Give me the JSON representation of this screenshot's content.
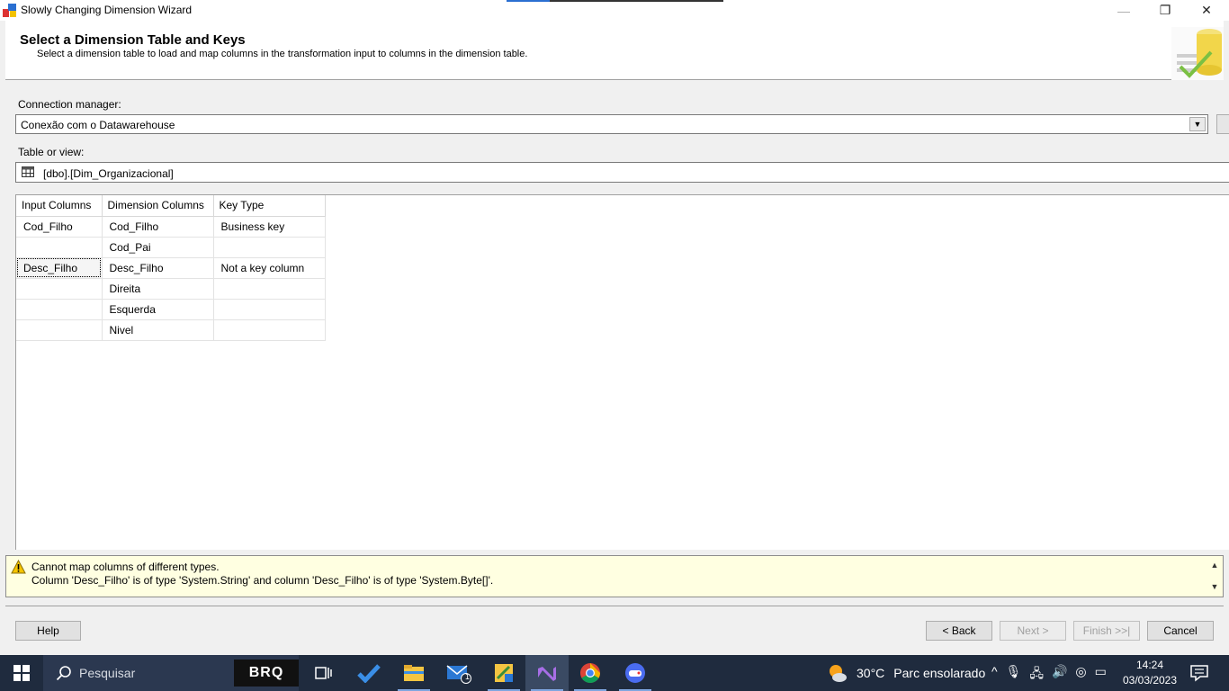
{
  "window": {
    "title": "Slowly Changing Dimension Wizard",
    "minimize_glyph": "—",
    "maximize_glyph": "❐",
    "close_glyph": "✕"
  },
  "header": {
    "title": "Select a Dimension Table and Keys",
    "description": "Select a dimension table to load and map columns in the transformation input to columns in the dimension table."
  },
  "connection": {
    "label": "Connection manager:",
    "value": "Conexão com o Datawarehouse"
  },
  "table_view": {
    "label": "Table or view:",
    "value": "[dbo].[Dim_Organizacional]"
  },
  "grid": {
    "headers": [
      "Input Columns",
      "Dimension Columns",
      "Key Type"
    ],
    "rows": [
      {
        "input": "Cod_Filho",
        "dimension": "Cod_Filho",
        "key": "Business key"
      },
      {
        "input": "",
        "dimension": "Cod_Pai",
        "key": ""
      },
      {
        "input": "Desc_Filho",
        "dimension": "Desc_Filho",
        "key": "Not a key column"
      },
      {
        "input": "",
        "dimension": "Direita",
        "key": ""
      },
      {
        "input": "",
        "dimension": "Esquerda",
        "key": ""
      },
      {
        "input": "",
        "dimension": "Nivel",
        "key": ""
      }
    ]
  },
  "message": {
    "line1": "Cannot map columns of different types.",
    "line2": "Column 'Desc_Filho' is of type 'System.String' and column 'Desc_Filho' is of type 'System.Byte[]'."
  },
  "buttons": {
    "help": "Help",
    "back": "< Back",
    "next": "Next >",
    "finish": "Finish >>|",
    "cancel": "Cancel"
  },
  "taskbar": {
    "search_placeholder": "Pesquisar",
    "brq_label": "BRQ",
    "mail_badge": "1",
    "weather_temp": "30°C",
    "weather_desc": "Parc ensolarado",
    "time": "14:24",
    "date": "03/03/2023",
    "icons": [
      "windows-start-icon",
      "search-icon",
      "task-view-icon",
      "todo-icon",
      "file-explorer-icon",
      "mail-icon",
      "sql-tool-icon",
      "visual-studio-icon",
      "chrome-icon",
      "game-icon",
      "weather-icon",
      "chevron-up-icon",
      "microphone-icon",
      "network-icon",
      "volume-icon",
      "camera-icon",
      "battery-icon",
      "notification-icon"
    ]
  },
  "colors": {
    "accent_blue": "#2a6fd1",
    "taskbar": "#1f2b3e",
    "message_bg": "#ffffe1"
  }
}
